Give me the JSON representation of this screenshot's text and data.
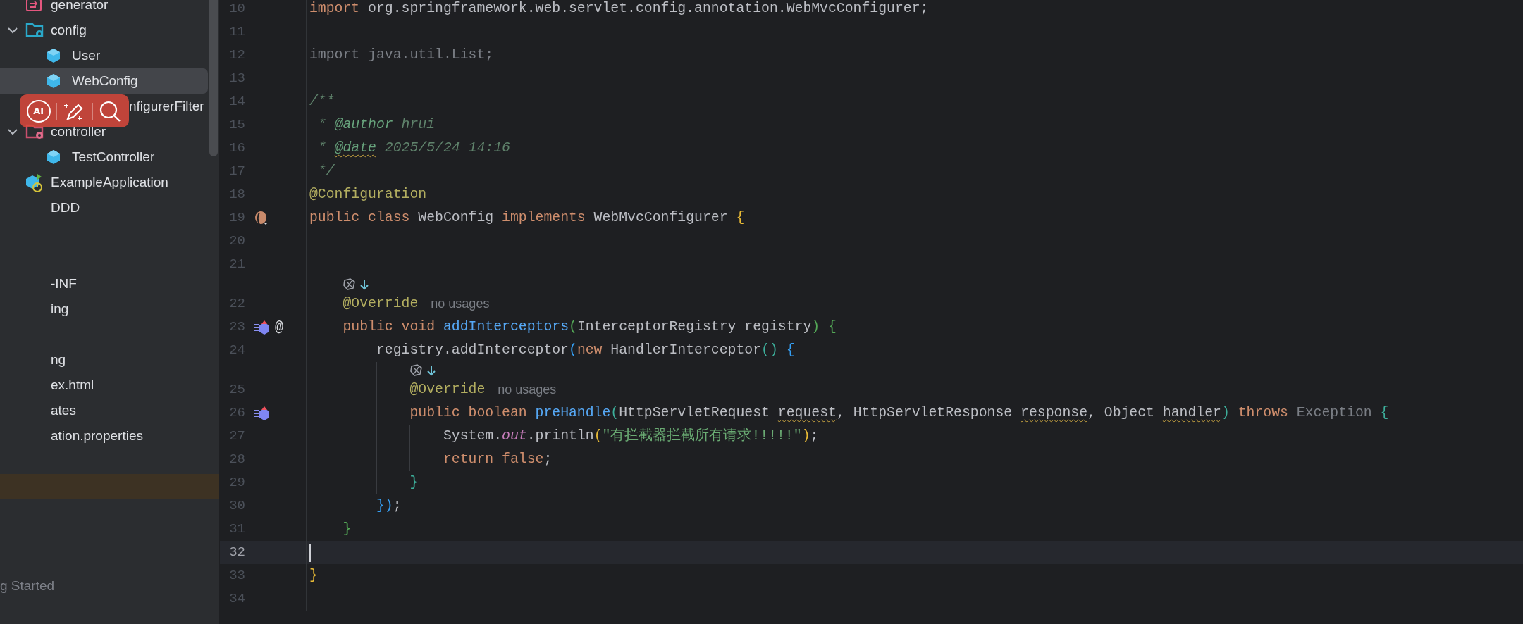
{
  "sidebar": {
    "tree": [
      {
        "children": [
          {
            "children": [
              {
                "label": "generator",
                "kind": "module",
                "selected": false
              },
              {
                "label": "config",
                "kind": "config",
                "expanded": true,
                "selected": false,
                "children": [
                  {
                    "label": "User",
                    "kind": "class",
                    "selected": false
                  },
                  {
                    "label": "WebConfig",
                    "kind": "class",
                    "selected": true
                  },
                  {
                    "label": "nfigurerFilter",
                    "kind": "covered",
                    "selected": false
                  }
                ]
              },
              {
                "label": "controller",
                "kind": "controller",
                "expanded": true,
                "selected": false,
                "children": [
                  {
                    "label": "TestController",
                    "kind": "class",
                    "selected": false
                  }
                ]
              }
            ]
          },
          {
            "label": "ExampleApplication",
            "kind": "app",
            "selected": false
          }
        ]
      },
      {
        "label": "DDD",
        "kind": "node",
        "selected": false
      },
      {
        "kind": "blank",
        "selected": false
      },
      {
        "kind": "blank",
        "selected": false
      },
      {
        "label": "-INF",
        "kind": "node",
        "selected": false
      },
      {
        "label": "ing",
        "kind": "node",
        "selected": false
      },
      {
        "kind": "blank",
        "selected": false
      },
      {
        "label": "ng",
        "kind": "node",
        "selected": false
      },
      {
        "label": "ex.html",
        "kind": "node",
        "selected": false
      },
      {
        "label": "ates",
        "kind": "node",
        "selected": false
      },
      {
        "label": "ation.properties",
        "kind": "node",
        "selected": false
      },
      {
        "kind": "blank",
        "selected": false
      },
      {
        "kind": "marked",
        "selected": false
      }
    ],
    "footer": "g Started"
  },
  "floating_toolbar": {
    "buttons": [
      {
        "kind": "ai",
        "text": "AI"
      },
      {
        "kind": "magic"
      },
      {
        "kind": "search"
      }
    ]
  },
  "editor": {
    "lines": [
      {
        "number": "10",
        "tokens": [
          {
            "text": "import",
            "kind": "keyword"
          },
          {
            "text": " org.springframework.web.servlet.config.annotation.WebMvcConfigurer;",
            "kind": "plain"
          }
        ]
      },
      {
        "number": "11"
      },
      {
        "number": "12",
        "tokens": [
          {
            "text": "import java.util.List;",
            "kind": "unused"
          }
        ]
      },
      {
        "number": "13"
      },
      {
        "number": "14",
        "tokens": [
          {
            "text": "/**",
            "kind": "comment"
          }
        ]
      },
      {
        "number": "15",
        "tokens": [
          {
            "text": " * ",
            "kind": "comment"
          },
          {
            "text": "@author",
            "kind": "doctag"
          },
          {
            "text": " hrui",
            "kind": "comment"
          }
        ]
      },
      {
        "number": "16",
        "tokens": [
          {
            "text": " * ",
            "kind": "comment"
          },
          {
            "text": "@date",
            "kind": "doctag",
            "warning": true
          },
          {
            "text": " 2025/5/24 14:16",
            "kind": "comment"
          }
        ]
      },
      {
        "number": "17",
        "tokens": [
          {
            "text": " */",
            "kind": "comment"
          }
        ]
      },
      {
        "number": "18",
        "tokens": [
          {
            "text": "@Configuration",
            "kind": "annotation"
          }
        ]
      },
      {
        "number": "19",
        "gutter": [
          {
            "kind": "bean"
          }
        ],
        "tokens": [
          {
            "text": "public class",
            "kind": "keyword"
          },
          {
            "text": " WebConfig ",
            "kind": "plain"
          },
          {
            "text": "implements",
            "kind": "keyword"
          },
          {
            "text": " WebMvcConfigurer ",
            "kind": "plain"
          },
          {
            "text": "{",
            "kind": "bracket",
            "color": "#e8ba36"
          }
        ]
      },
      {
        "number": "20"
      },
      {
        "number": "21"
      },
      {
        "kind": "inlay"
      },
      {
        "number": "22",
        "tokens": [
          {
            "text": "    @Override",
            "kind": "annotation"
          },
          {
            "text": "no usages",
            "kind": "hint"
          }
        ]
      },
      {
        "number": "23",
        "gutter": [
          {
            "kind": "override"
          },
          {
            "kind": "text",
            "text": "@"
          }
        ],
        "tokens": [
          {
            "text": "    public void ",
            "kind": "keyword"
          },
          {
            "text": "addInterceptors",
            "kind": "method"
          },
          {
            "text": "(",
            "kind": "bracket",
            "color": "#54a857"
          },
          {
            "text": "InterceptorRegistry registry",
            "kind": "plain"
          },
          {
            "text": ")",
            "kind": "bracket",
            "color": "#54a857"
          },
          {
            "text": " {",
            "kind": "bracket",
            "color": "#54a857"
          }
        ]
      },
      {
        "number": "24",
        "tokens": [
          {
            "text": "        registry.addInterceptor",
            "kind": "plain"
          },
          {
            "text": "(",
            "kind": "bracket",
            "color": "#359ff4"
          },
          {
            "text": "new",
            "kind": "keyword"
          },
          {
            "text": " HandlerInterceptor",
            "kind": "plain"
          },
          {
            "text": "()",
            "kind": "bracket",
            "color": "#3dae9a"
          },
          {
            "text": " {",
            "kind": "bracket",
            "color": "#359ff4"
          }
        ]
      },
      {
        "kind": "inlay"
      },
      {
        "number": "25",
        "tokens": [
          {
            "text": "            @Override",
            "kind": "annotation"
          },
          {
            "text": "no usages",
            "kind": "hint"
          }
        ]
      },
      {
        "number": "26",
        "gutter": [
          {
            "kind": "override"
          }
        ],
        "tokens": [
          {
            "text": "            public boolean ",
            "kind": "keyword"
          },
          {
            "text": "preHandle",
            "kind": "method"
          },
          {
            "text": "(",
            "kind": "bracket",
            "color": "#3dae9a"
          },
          {
            "text": "HttpServletRequest ",
            "kind": "plain"
          },
          {
            "text": "request",
            "kind": "plain",
            "warning": true
          },
          {
            "text": ", HttpServletResponse ",
            "kind": "plain"
          },
          {
            "text": "response",
            "kind": "plain",
            "warning": true
          },
          {
            "text": ", Object ",
            "kind": "plain"
          },
          {
            "text": "handler",
            "kind": "plain",
            "warning": true
          },
          {
            "text": ")",
            "kind": "bracket",
            "color": "#3dae9a"
          },
          {
            "text": " throws ",
            "kind": "keyword"
          },
          {
            "text": "Exception",
            "kind": "unused"
          },
          {
            "text": " {",
            "kind": "bracket",
            "color": "#3dae9a"
          }
        ]
      },
      {
        "number": "27",
        "tokens": [
          {
            "text": "                System.",
            "kind": "plain"
          },
          {
            "text": "out",
            "kind": "field"
          },
          {
            "text": ".println",
            "kind": "plain"
          },
          {
            "text": "(",
            "kind": "bracket",
            "color": "#e8ba36"
          },
          {
            "text": "\"有拦截器拦截所有请求!!!!!\"",
            "kind": "string"
          },
          {
            "text": ")",
            "kind": "bracket",
            "color": "#e8ba36"
          },
          {
            "text": ";",
            "kind": "plain"
          }
        ]
      },
      {
        "number": "28",
        "tokens": [
          {
            "text": "                return false",
            "kind": "keyword"
          },
          {
            "text": ";",
            "kind": "plain"
          }
        ]
      },
      {
        "number": "29",
        "tokens": [
          {
            "text": "            }",
            "kind": "bracket",
            "color": "#3dae9a"
          }
        ]
      },
      {
        "number": "30",
        "tokens": [
          {
            "text": "        })",
            "kind": "bracket",
            "color": "#359ff4"
          },
          {
            "text": ";",
            "kind": "plain"
          }
        ]
      },
      {
        "number": "31",
        "tokens": [
          {
            "text": "    }",
            "kind": "bracket",
            "color": "#54a857"
          }
        ]
      },
      {
        "number": "32",
        "current": true
      },
      {
        "number": "33",
        "tokens": [
          {
            "text": "}",
            "kind": "bracket",
            "color": "#e8ba36"
          }
        ]
      },
      {
        "number": "34"
      }
    ]
  }
}
